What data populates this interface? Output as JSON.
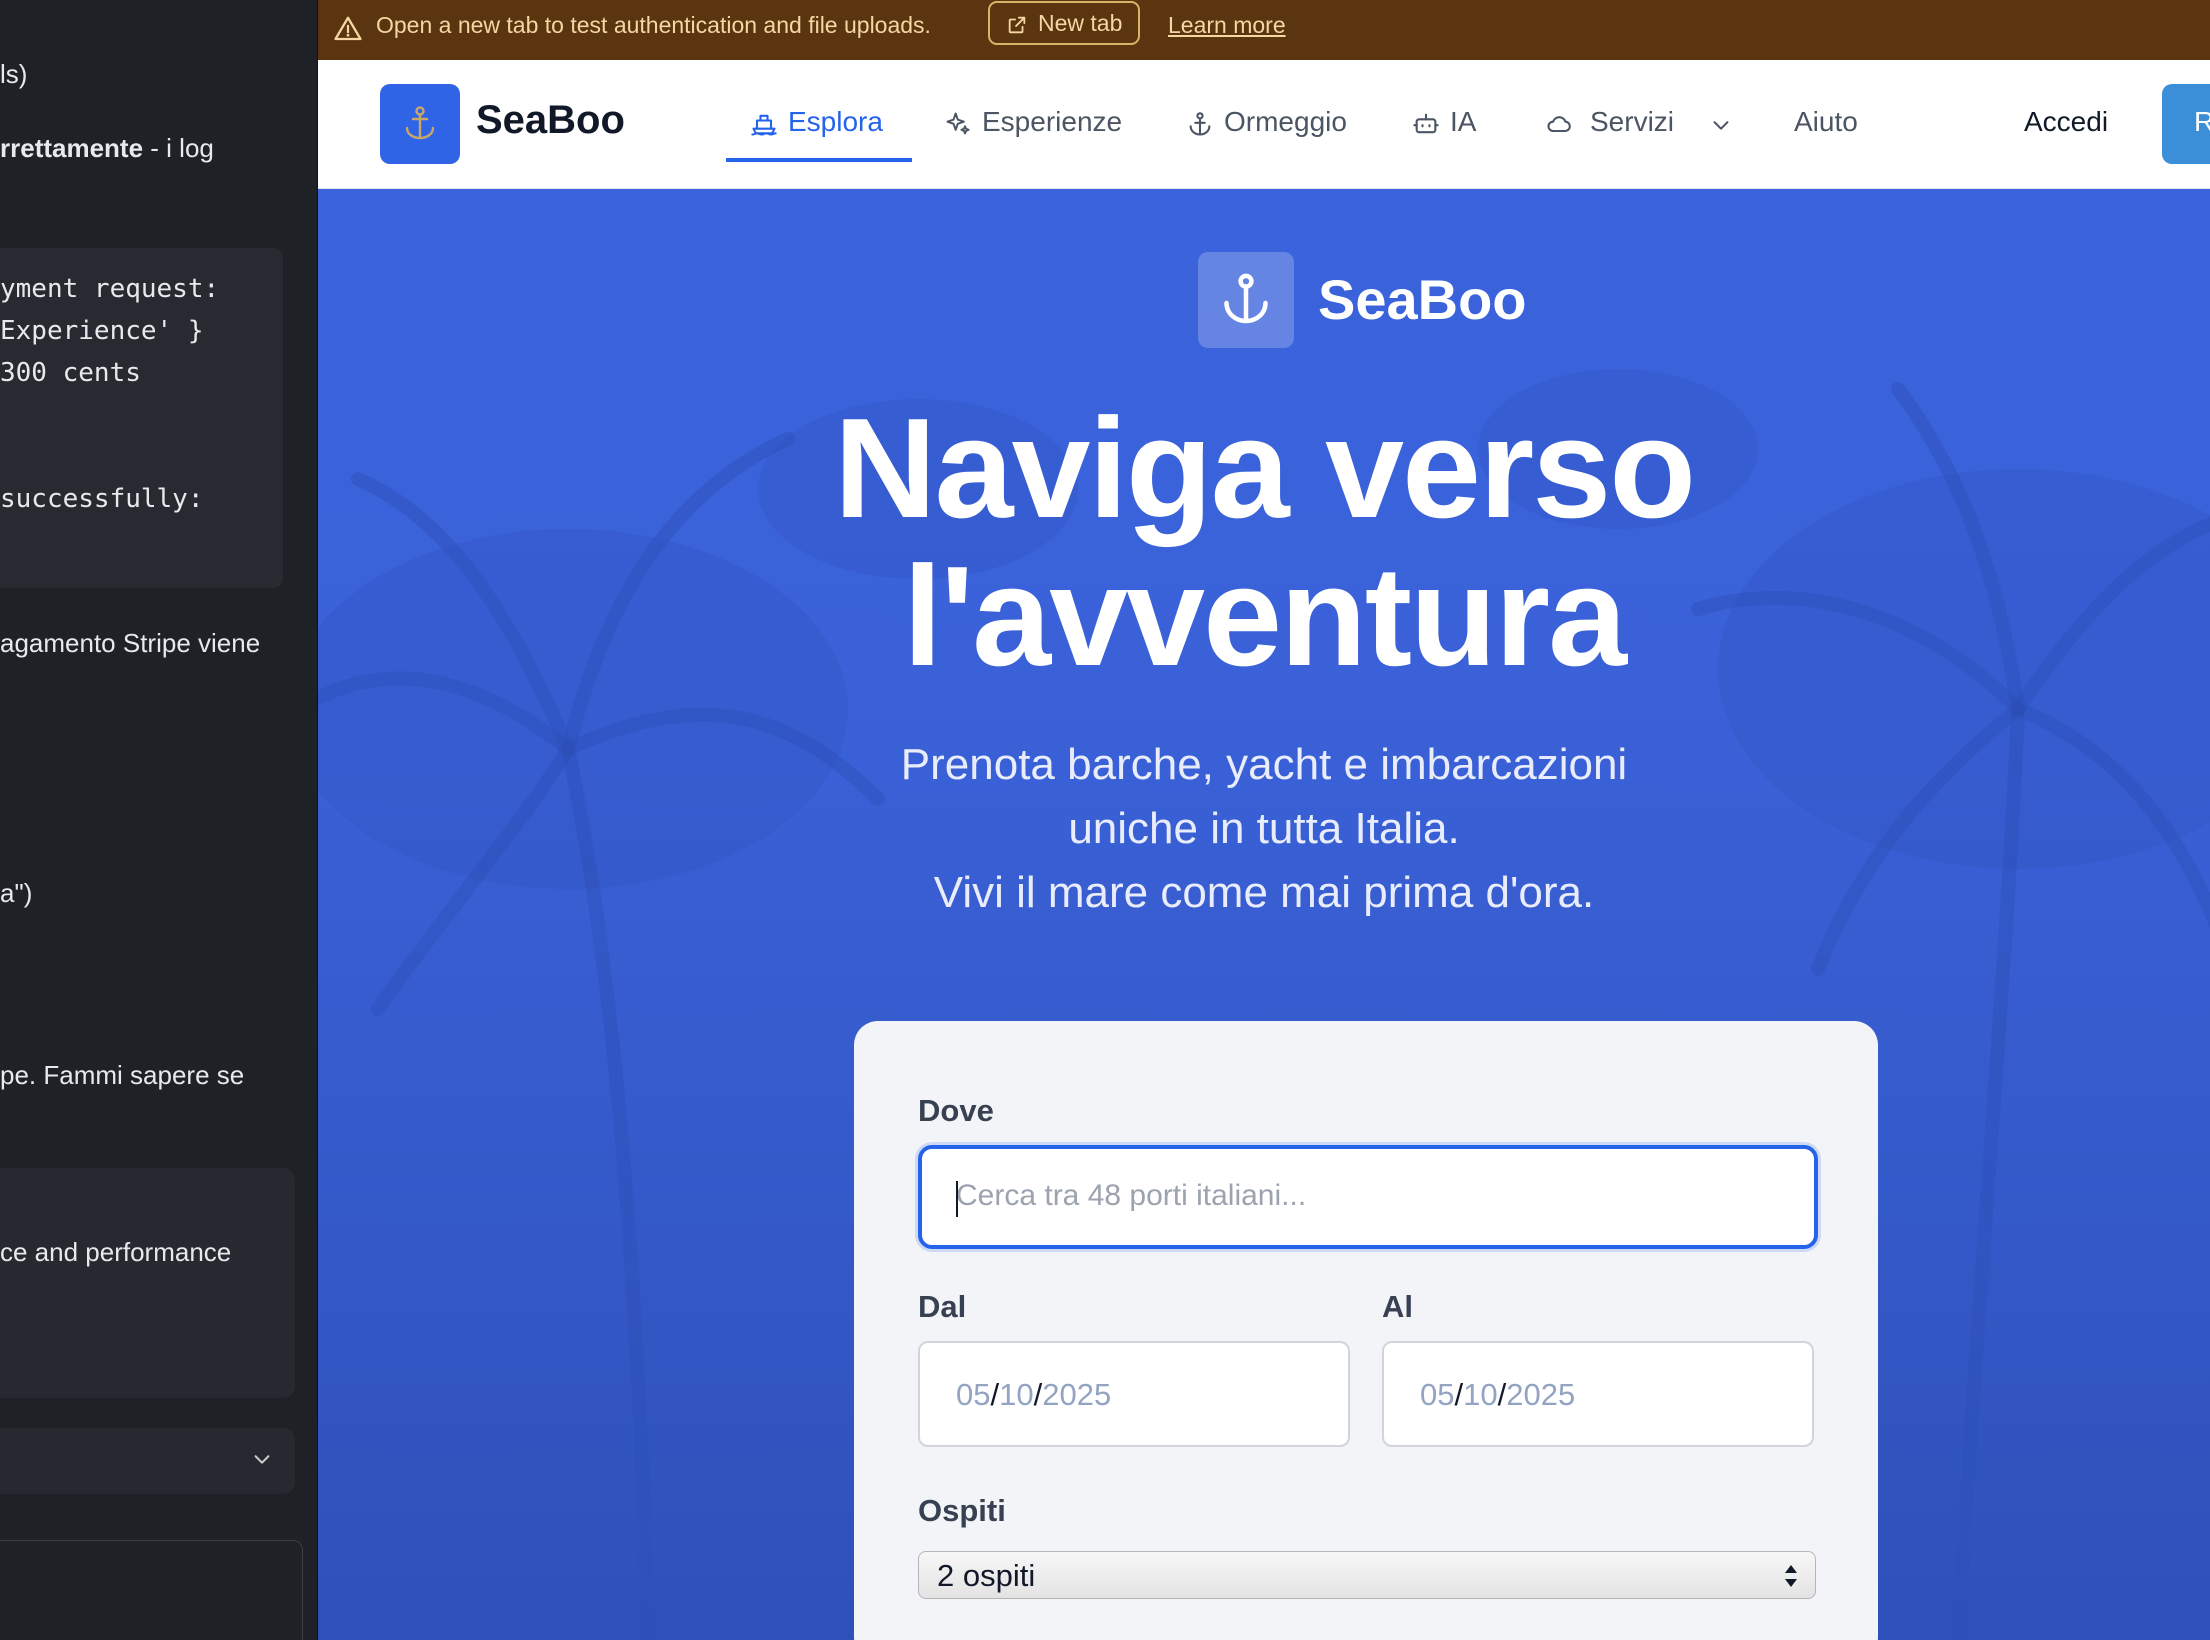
{
  "left_panel": {
    "lines": [
      {
        "id": "l1",
        "text": "ls)"
      },
      {
        "id": "l2a",
        "text": "rrettamente"
      },
      {
        "id": "l2b",
        "text": " - i log"
      },
      {
        "id": "c1",
        "text": "yment request:"
      },
      {
        "id": "c2",
        "text": " Experience' }"
      },
      {
        "id": "c3",
        "text": "300 cents"
      },
      {
        "id": "c4",
        "text": " successfully:"
      },
      {
        "id": "l3",
        "text": "agamento Stripe viene"
      },
      {
        "id": "l4",
        "text": "a\")"
      },
      {
        "id": "l5",
        "text": "pe. Fammi sapere se"
      },
      {
        "id": "l6",
        "text": "ce and performance"
      }
    ]
  },
  "banner": {
    "message": "Open a new tab to test authentication and file uploads.",
    "new_tab_label": "New tab",
    "learn_more_label": "Learn more"
  },
  "nav": {
    "brand": "SeaBoo",
    "items": [
      {
        "label": "Esplora",
        "icon": "boat-icon",
        "active": true
      },
      {
        "label": "Esperienze",
        "icon": "sparkles-icon",
        "active": false
      },
      {
        "label": "Ormeggio",
        "icon": "anchor-icon",
        "active": false
      },
      {
        "label": "IA",
        "icon": "robot-icon",
        "active": false
      },
      {
        "label": "Servizi",
        "icon": "cloud-icon",
        "active": false
      }
    ],
    "help_label": "Aiuto",
    "login_label": "Accedi",
    "register_label_partial": "R"
  },
  "hero": {
    "brand": "SeaBoo",
    "title_line1": "Naviga verso",
    "title_line2": "l'avventura",
    "subtitle_line1": "Prenota barche, yacht e imbarcazioni",
    "subtitle_line2": "uniche in tutta Italia.",
    "subtitle_line3": "Vivi il mare come mai prima d'ora."
  },
  "search_card": {
    "where_label": "Dove",
    "where_placeholder": "Cerca tra 48 porti italiani...",
    "from_label": "Dal",
    "to_label": "Al",
    "from_date": {
      "day": "05",
      "month": "10",
      "year": "2025"
    },
    "to_date": {
      "day": "05",
      "month": "10",
      "year": "2025"
    },
    "guests_label": "Ospiti",
    "guests_value": "2 ospiti"
  },
  "colors": {
    "primary": "#2563eb",
    "hero_blue": "#3a63dc",
    "banner_bg": "#5a3510",
    "banner_text": "#f4d7a2",
    "left_panel_bg": "#1e2126"
  }
}
